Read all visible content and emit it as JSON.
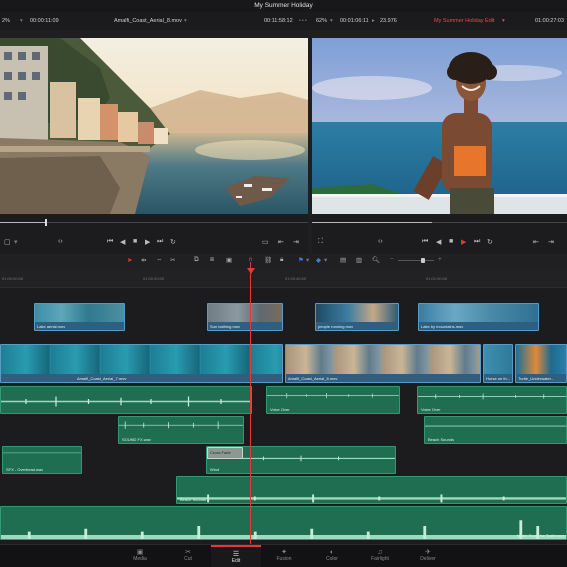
{
  "window": {
    "title": "My Summer Holiday"
  },
  "source_viewer": {
    "zoom": "2%",
    "timecode_left": "00:00:11:09",
    "clip_name": "Amalfi_Coast_Aerial_8.mov",
    "timecode_right": "00:11:58:12"
  },
  "timeline_viewer": {
    "zoom": "62%",
    "duration": "00:01:06:11",
    "speed": "23.976",
    "timeline_name": "My Summer Holiday Edit",
    "timecode": "01:00:27:03"
  },
  "ruler": {
    "ticks": [
      "01:00:00:00",
      "01:00:20:00",
      "01:00:40:00",
      "01:01:00:00"
    ]
  },
  "tracks": {
    "v2": [
      {
        "label": "Lake aerial.mov"
      },
      {
        "label": "Sun bathing.mov"
      },
      {
        "label": "people running.mov"
      },
      {
        "label": "Lake by mountains.mov"
      }
    ],
    "v1": [
      {
        "label": "Amalfi_Coast_Aerial_7.mov"
      },
      {
        "label": "Amalfi_Coast_Aerial_8.mov"
      },
      {
        "label": "Horse on th..."
      },
      {
        "label": "Turtle_Underwater..."
      }
    ],
    "a1": [
      {
        "label": ""
      },
      {
        "label": "Voice Over"
      },
      {
        "label": "Voice Over"
      }
    ],
    "a2": [
      {
        "label": "SOUND FX.wav"
      },
      {
        "label": "Beach Sounds"
      }
    ],
    "a3": [
      {
        "label": "SFX - Overhead.wav"
      },
      {
        "label": "Wind"
      },
      {
        "label": "Cross Fade"
      }
    ],
    "a4": [
      {
        "label": "Beach Sounds"
      }
    ],
    "a5": [
      {
        "label": "Music Score for Trailer.mov"
      }
    ]
  },
  "pages": [
    {
      "icon": "▣",
      "label": "Media"
    },
    {
      "icon": "✂",
      "label": "Cut"
    },
    {
      "icon": "☰",
      "label": "Edit"
    },
    {
      "icon": "✦",
      "label": "Fusion"
    },
    {
      "icon": "◐",
      "label": "Color"
    },
    {
      "icon": "♫",
      "label": "Fairlight"
    },
    {
      "icon": "✈",
      "label": "Deliver"
    }
  ],
  "colors": {
    "accent": "#e53935",
    "video_clip": "#2f5f80",
    "audio_clip": "#1f6e52"
  }
}
